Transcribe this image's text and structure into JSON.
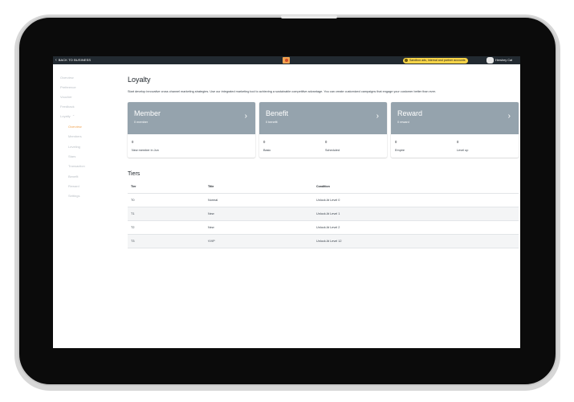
{
  "topbar": {
    "back_label": "BACK TO BUSINESS",
    "sandbox_label": "Sandbox ads, internal and partner accounts",
    "user_name": "Hershey Cat"
  },
  "sidebar": {
    "items": [
      {
        "label": "Overview"
      },
      {
        "label": "Preference"
      },
      {
        "label": "Voucher"
      },
      {
        "label": "Feedback"
      },
      {
        "label": "Loyalty"
      }
    ],
    "loyalty_subitems": [
      {
        "label": "Overview"
      },
      {
        "label": "Members"
      },
      {
        "label": "Leveling"
      },
      {
        "label": "Stars"
      },
      {
        "label": "Transaction"
      },
      {
        "label": "Benefit"
      },
      {
        "label": "Reward"
      },
      {
        "label": "Settings"
      }
    ]
  },
  "main": {
    "title": "Loyalty",
    "description": "Start develop innovative cross channel marketing strategies. Use our integrated marketing tool to achieving a sustainable competitive advantage. You can create customized campaigns that engage your customer better than ever.",
    "cards": [
      {
        "title": "Member",
        "subtitle": "0 member",
        "stats": [
          {
            "value": "0",
            "label": "New member in Jun"
          }
        ]
      },
      {
        "title": "Benefit",
        "subtitle": "0 benefit",
        "stats": [
          {
            "value": "0",
            "label": "Basic"
          },
          {
            "value": "0",
            "label": "Scheduled"
          }
        ]
      },
      {
        "title": "Reward",
        "subtitle": "0 reward",
        "stats": [
          {
            "value": "0",
            "label": "Empire"
          },
          {
            "value": "0",
            "label": "Level up"
          }
        ]
      }
    ],
    "tiers": {
      "title": "Tiers",
      "columns": [
        "Tier",
        "Title",
        "Condition"
      ],
      "rows": [
        [
          "T0",
          "Normal",
          "Unlock At Level 0"
        ],
        [
          "T1",
          "New",
          "Unlock At Level 1"
        ],
        [
          "T2",
          "New",
          "Unlock At Level 2"
        ],
        [
          "T3",
          "VVIP",
          "Unlock At Level 12"
        ]
      ]
    }
  },
  "colors": {
    "topbar": "#222a31",
    "accent": "#f0a24f",
    "card_header": "#95a3ad",
    "sandbox_badge": "#f8d447"
  }
}
